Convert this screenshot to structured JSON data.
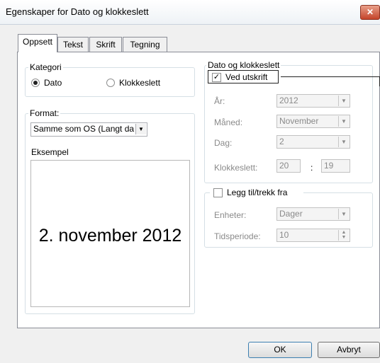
{
  "window": {
    "title": "Egenskaper for Dato og klokkeslett",
    "close_glyph": "✕"
  },
  "tabs": [
    {
      "label": "Oppsett",
      "active": true
    },
    {
      "label": "Tekst",
      "active": false
    },
    {
      "label": "Skrift",
      "active": false
    },
    {
      "label": "Tegning",
      "active": false
    }
  ],
  "kategori": {
    "label": "Kategori",
    "options": [
      {
        "label": "Dato",
        "selected": true
      },
      {
        "label": "Klokkeslett",
        "selected": false
      }
    ]
  },
  "format": {
    "label": "Format:",
    "value": "Samme som OS (Langt da"
  },
  "eksempel": {
    "label": "Eksempel",
    "preview": "2. november 2012"
  },
  "dato_klokkeslett": {
    "label": "Dato og klokkeslett",
    "ved_utskrift": {
      "label": "Ved utskrift",
      "checked": true
    },
    "ar": {
      "label": "År:",
      "value": "2012"
    },
    "maned": {
      "label": "Måned:",
      "value": "November"
    },
    "dag": {
      "label": "Dag:",
      "value": "2"
    },
    "klokkeslett": {
      "label": "Klokkeslett:",
      "hour": "20",
      "sep": ":",
      "minute": "19"
    }
  },
  "legg_til": {
    "label": "Legg til/trekk fra",
    "checked": false,
    "enheter": {
      "label": "Enheter:",
      "value": "Dager"
    },
    "tidsperiode": {
      "label": "Tidsperiode:",
      "value": "10"
    }
  },
  "buttons": {
    "ok": "OK",
    "cancel": "Avbryt"
  },
  "colors": {
    "close_button": "#c4442a",
    "panel_bg": "#ffffff",
    "window_bg": "#f0f0f0"
  }
}
